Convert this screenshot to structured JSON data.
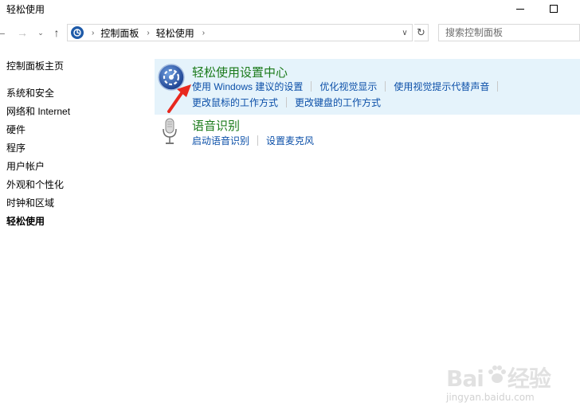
{
  "window": {
    "title": "轻松使用"
  },
  "navbar": {
    "breadcrumbs": [
      "控制面板",
      "轻松使用"
    ],
    "search_placeholder": "搜索控制面板"
  },
  "sidebar": {
    "home_label": "控制面板主页",
    "items": [
      {
        "label": "系统和安全"
      },
      {
        "label": "网络和 Internet"
      },
      {
        "label": "硬件"
      },
      {
        "label": "程序"
      },
      {
        "label": "用户帐户"
      },
      {
        "label": "外观和个性化"
      },
      {
        "label": "时钟和区域"
      },
      {
        "label": "轻松使用",
        "active": true
      }
    ]
  },
  "main": {
    "categories": [
      {
        "title": "轻松使用设置中心",
        "icon": "ease-of-access-icon",
        "links_row1": [
          "使用 Windows 建议的设置",
          "优化视觉显示",
          "使用视觉提示代替声音"
        ],
        "links_row2": [
          "更改鼠标的工作方式",
          "更改键盘的工作方式"
        ]
      },
      {
        "title": "语音识别",
        "icon": "microphone-icon",
        "links_row1": [
          "启动语音识别",
          "设置麦克风"
        ]
      }
    ]
  },
  "watermark": {
    "brand": "Bai",
    "brand_suffix": "经验",
    "url": "jingyan.baidu.com"
  },
  "colors": {
    "highlight_bg": "#e5f3fb",
    "category_title": "#1a7a1a",
    "link": "#0b4fa8",
    "annotation_arrow": "#e8281e"
  }
}
